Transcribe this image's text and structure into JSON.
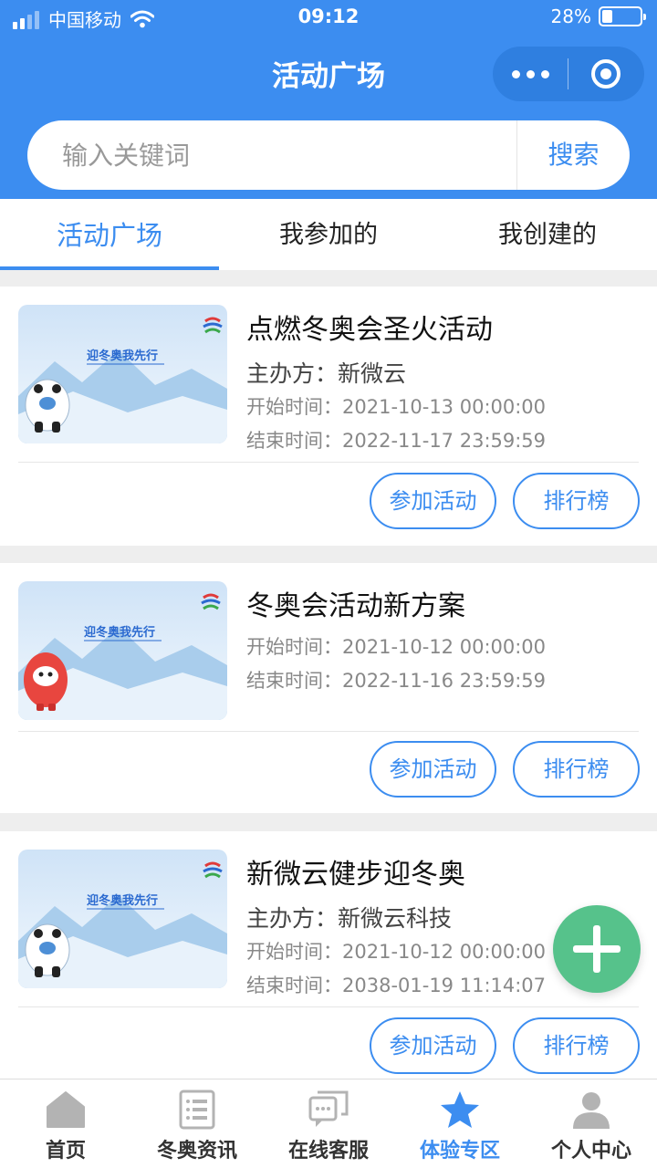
{
  "status_bar": {
    "carrier": "中国移动",
    "time": "09:12",
    "battery": "28%",
    "battery_level": 0.28
  },
  "header": {
    "title": "活动广场"
  },
  "search": {
    "placeholder": "输入关键词",
    "button": "搜索"
  },
  "tabs": [
    {
      "label": "活动广场",
      "active": true
    },
    {
      "label": "我参加的",
      "active": false
    },
    {
      "label": "我创建的",
      "active": false
    }
  ],
  "activities": [
    {
      "title": "点燃冬奥会圣火活动",
      "organizer": "主办方：新微云",
      "start": "开始时间：2021-10-13 00:00:00",
      "end": "结束时间：2022-11-17 23:59:59",
      "banner_text": "迎冬奥我先行",
      "logo_text": "Beijing 2022",
      "mascot": "panda-mascot",
      "join_label": "参加活动",
      "rank_label": "排行榜"
    },
    {
      "title": "冬奥会活动新方案",
      "start": "开始时间：2021-10-12 00:00:00",
      "end": "结束时间：2022-11-16 23:59:59",
      "banner_text": "迎冬奥我先行",
      "logo_text": "Beijing 2022",
      "mascot": "lantern-mascot",
      "join_label": "参加活动",
      "rank_label": "排行榜"
    },
    {
      "title": "新微云健步迎冬奥",
      "organizer": "主办方：新微云科技",
      "start": "开始时间：2021-10-12 00:00:00",
      "end": "结束时间：2038-01-19 11:14:07",
      "banner_text": "迎冬奥我先行",
      "logo_text": "Beijing 2022",
      "mascot": "panda-mascot",
      "join_label": "参加活动",
      "rank_label": "排行榜"
    }
  ],
  "fab": {
    "icon": "plus-icon",
    "color": "#56c28b"
  },
  "tabbar": [
    {
      "label": "首页",
      "icon": "home-icon"
    },
    {
      "label": "冬奥资讯",
      "icon": "news-icon"
    },
    {
      "label": "在线客服",
      "icon": "chat-icon"
    },
    {
      "label": "体验专区",
      "icon": "star-icon",
      "active": true
    },
    {
      "label": "个人中心",
      "icon": "user-icon"
    }
  ],
  "colors": {
    "primary": "#3c8df0",
    "background": "#eeeeee",
    "fab": "#56c28b"
  }
}
